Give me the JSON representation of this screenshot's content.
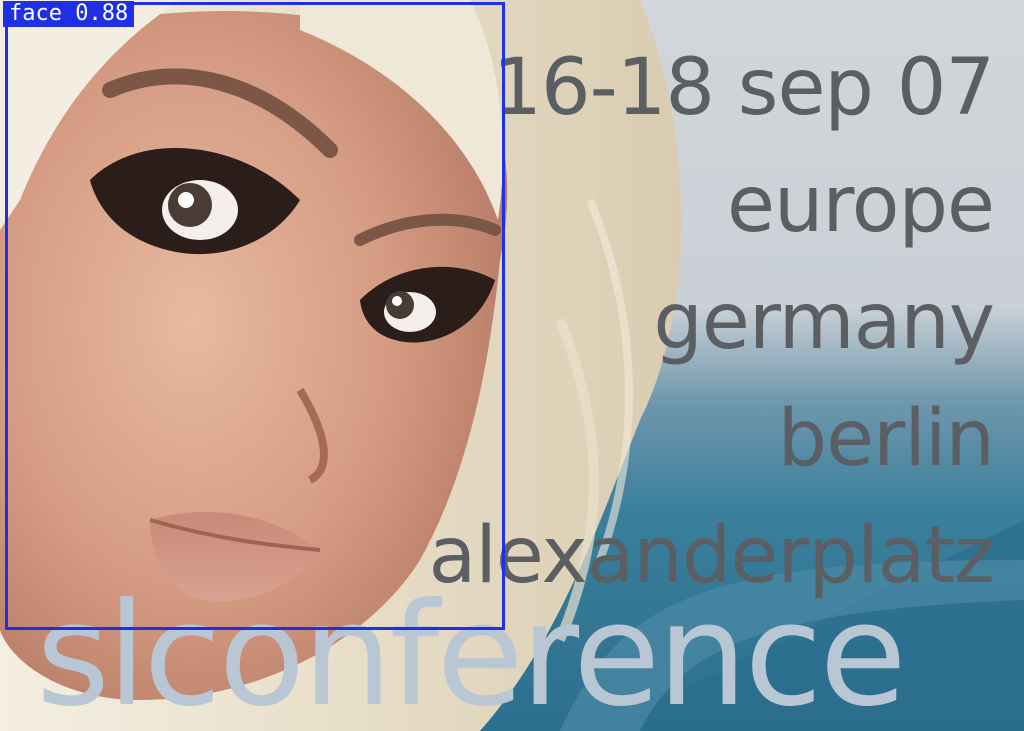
{
  "poster": {
    "lines": [
      "16-18 sep 07",
      "europe",
      "germany",
      "berlin",
      "alexanderplatz"
    ],
    "brand": "slconference"
  },
  "detection": {
    "label": "face 0.88",
    "color": "#1f2fe6"
  }
}
